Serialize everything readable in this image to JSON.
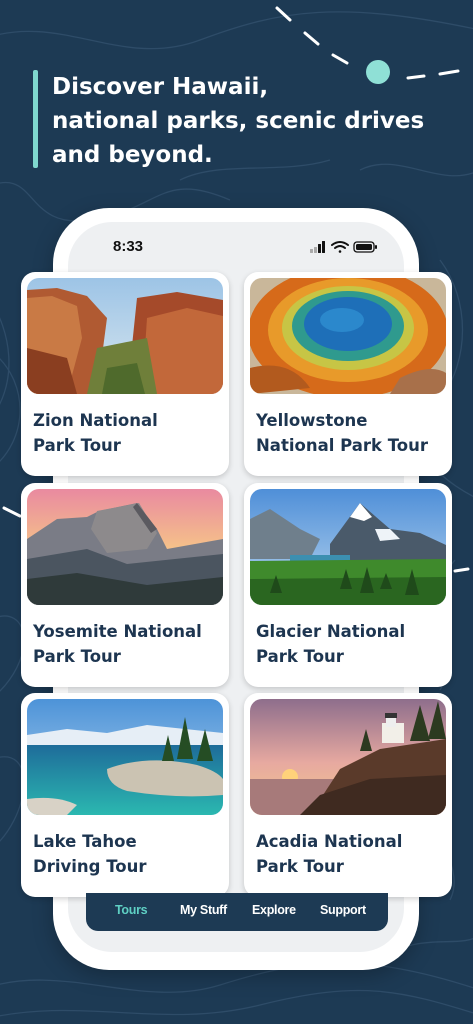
{
  "headline": {
    "line1": "Discover Hawaii,",
    "line2": "national parks, scenic drives",
    "line3": "and beyond."
  },
  "phone": {
    "status_time": "8:33"
  },
  "cards": [
    {
      "line1": "Zion National",
      "line2": "Park Tour",
      "image": "zion-canyon-image"
    },
    {
      "line1": "Yellowstone",
      "line2": "National Park Tour",
      "image": "grand-prismatic-spring-image"
    },
    {
      "line1": "Yosemite National",
      "line2": "Park Tour",
      "image": "half-dome-image"
    },
    {
      "line1": "Glacier National",
      "line2": "Park Tour",
      "image": "glacier-mountains-image"
    },
    {
      "line1": "Lake Tahoe",
      "line2": "Driving Tour",
      "image": "lake-tahoe-image"
    },
    {
      "line1": "Acadia National",
      "line2": "Park Tour",
      "image": "acadia-lighthouse-image"
    }
  ],
  "tabs": [
    {
      "label": "Tours",
      "active": true
    },
    {
      "label": "My Stuff",
      "active": false
    },
    {
      "label": "Explore",
      "active": false
    },
    {
      "label": "Support",
      "active": false
    }
  ],
  "colors": {
    "background": "#1d3a54",
    "accent": "#7fd8cf",
    "card_title": "#1d3550",
    "active_tab": "#5fd0c4"
  }
}
